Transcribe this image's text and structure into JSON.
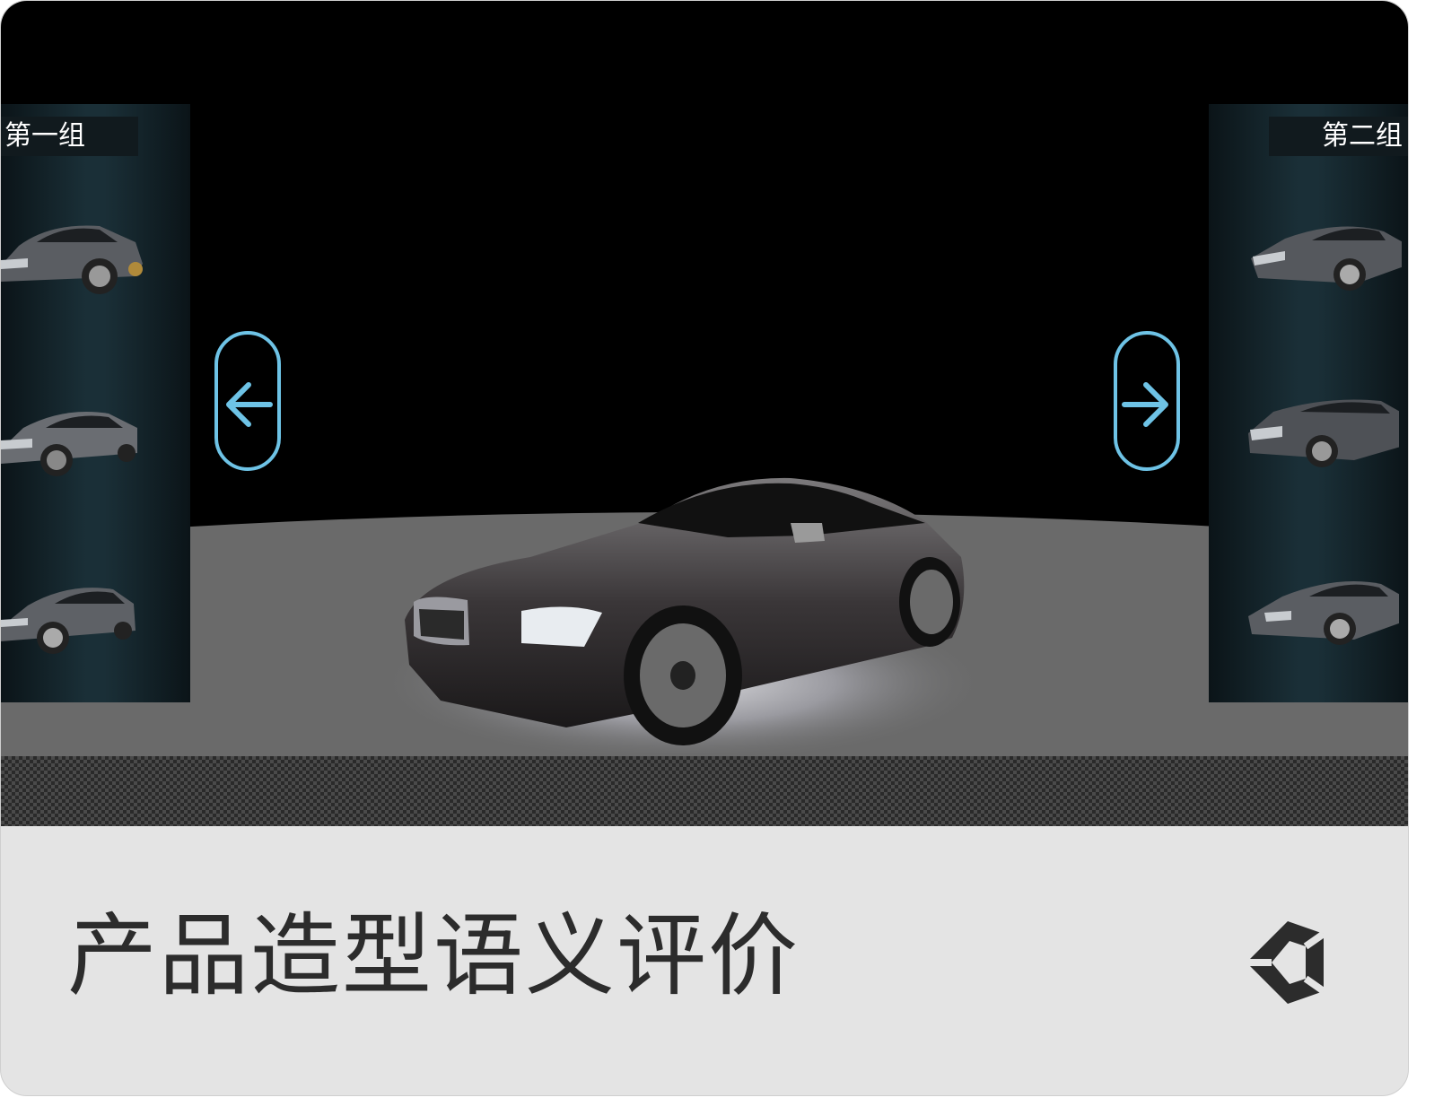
{
  "viewer": {
    "left_group_label": "第一组",
    "right_group_label": "第二组",
    "left_group_thumbs": [
      "car-thumb",
      "car-thumb",
      "car-thumb"
    ],
    "right_group_thumbs": [
      "car-thumb",
      "car-thumb",
      "car-thumb"
    ],
    "prev_icon": "arrow-left-icon",
    "next_icon": "arrow-right-icon",
    "accent_color": "#6ec3e6"
  },
  "footer": {
    "title": "产品造型语义评价",
    "logo_icon": "unity-logo-icon"
  }
}
